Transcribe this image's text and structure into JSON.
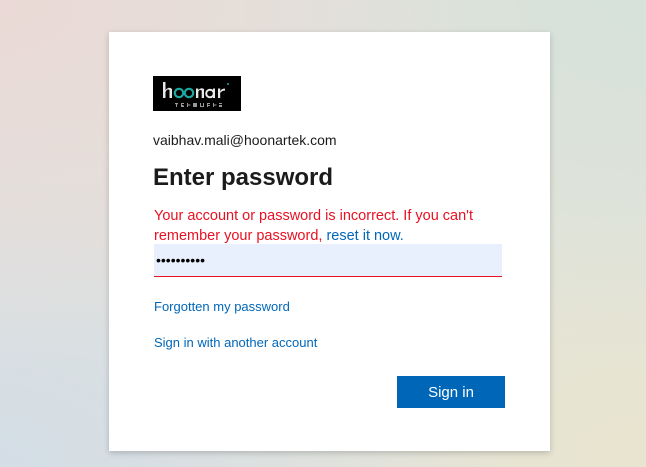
{
  "brand": {
    "logo_text": "hoonar",
    "logo_subtext": "TEKWURKS"
  },
  "account": {
    "email": "vaibhav.mali@hoonartek.com"
  },
  "form": {
    "title": "Enter password",
    "error_text": "Your account or password is incorrect. If you can't remember your password, ",
    "reset_link": "reset it now.",
    "password_value": "••••••••••",
    "forgot_link": "Forgotten my password",
    "another_account_link": "Sign in with another account",
    "signin_label": "Sign in"
  },
  "colors": {
    "accent": "#0067b8",
    "error": "#e81123",
    "input_bg": "#e8f0fe"
  },
  "icons": {
    "logo": "hoonar-tekwurks-logo"
  }
}
